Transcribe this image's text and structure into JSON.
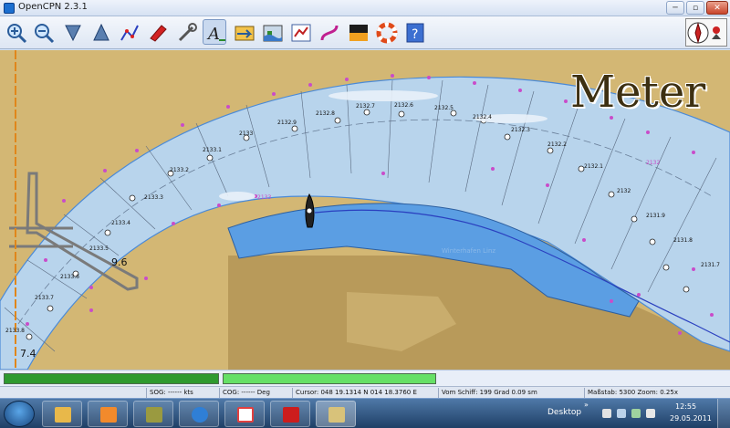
{
  "window": {
    "title": "OpenCPN 2.3.1",
    "minimize": "─",
    "maximize": "▫",
    "close": "✕"
  },
  "toolbar": {
    "tools": [
      {
        "name": "zoom-in-icon"
      },
      {
        "name": "zoom-out-icon"
      },
      {
        "name": "scale-down-icon"
      },
      {
        "name": "scale-up-icon"
      },
      {
        "name": "route-icon"
      },
      {
        "name": "follow-ship-icon"
      },
      {
        "name": "settings-icon"
      },
      {
        "name": "text-toggle-icon",
        "active": true
      },
      {
        "name": "current-icon"
      },
      {
        "name": "tide-icon"
      },
      {
        "name": "route-manager-icon"
      },
      {
        "name": "track-icon"
      },
      {
        "name": "color-scheme-icon"
      },
      {
        "name": "mob-icon"
      },
      {
        "name": "help-icon"
      }
    ]
  },
  "chart": {
    "unit_label": "Meter",
    "depth_labels": [
      "9.6",
      "7.4"
    ],
    "river_marks": [
      "2133.8",
      "2133.7",
      "2133.6",
      "2133.5",
      "2133.4",
      "2133.3",
      "2133.2",
      "2133.1",
      "2133",
      "2132.9",
      "2132.8",
      "2132.7",
      "2132.6",
      "2132.5",
      "2132.4",
      "2132.3",
      "2132.2",
      "2132.1",
      "2132",
      "2131.9",
      "2131.8",
      "2131.7"
    ],
    "pink_labels": [
      "2133",
      "2132"
    ],
    "harbour_label": "Winterhafen Linz"
  },
  "status": {
    "sog": "SOG: ------ kts",
    "cog": "COG: ------ Deg",
    "cursor": "Cursor: 048 19.1314 N 014 18.3760 E",
    "vom_schiff": "Vom Schiff: 199 Grad     0.09 sm",
    "scale": "Maßstab:      5300  Zoom: 0.25x"
  },
  "taskbar": {
    "apps": [
      {
        "name": "explorer",
        "color": "#e8b84a"
      },
      {
        "name": "media-player",
        "color": "#f28a2c"
      },
      {
        "name": "gallery",
        "color": "#9a9a40"
      },
      {
        "name": "internet-explorer",
        "color": "#2f7fd6"
      },
      {
        "name": "chart-tool",
        "color": "#e14040"
      },
      {
        "name": "acrobat",
        "color": "#cc1d1d"
      },
      {
        "name": "opencpn",
        "color": "#d8c27a",
        "active": true
      }
    ],
    "desktop_label": "Desktop",
    "desktop_arrows": "»",
    "time": "12:55",
    "date": "29.05.2011"
  },
  "colors": {
    "land": "#d3b774",
    "land_dark": "#b89a5a",
    "water": "#b8d4ec",
    "deep_water": "#5b9ee3",
    "magenta": "#c94cc9"
  }
}
